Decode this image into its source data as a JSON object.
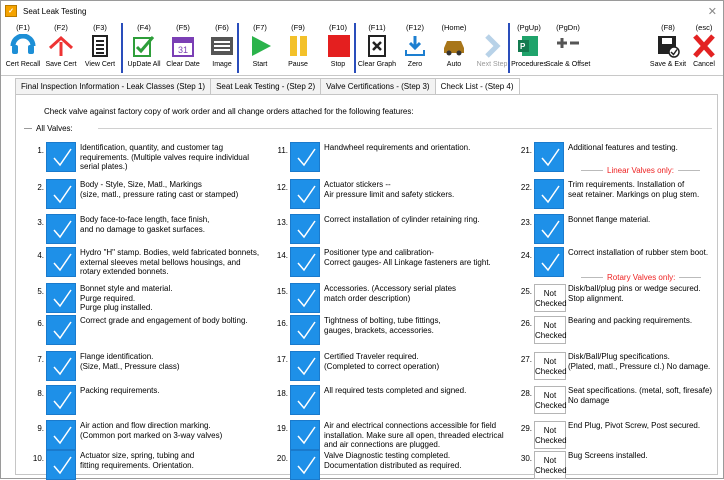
{
  "window": {
    "title": "Seat Leak Testing"
  },
  "toolbar": [
    {
      "key": "(F1)",
      "label": "Cert Recall",
      "icon": "cert-recall-icon"
    },
    {
      "key": "(F2)",
      "label": "Save Cert",
      "icon": "save-cert-icon"
    },
    {
      "key": "(F3)",
      "label": "View Cert",
      "icon": "view-cert-icon"
    },
    {
      "key": "(F4)",
      "label": "UpDate All",
      "icon": "update-all-icon"
    },
    {
      "key": "(F5)",
      "label": "Clear Date",
      "icon": "clear-date-icon"
    },
    {
      "key": "(F6)",
      "label": "Image",
      "icon": "image-icon"
    },
    {
      "key": "(F7)",
      "label": "Start",
      "icon": "start-icon"
    },
    {
      "key": "(F9)",
      "label": "Pause",
      "icon": "pause-icon"
    },
    {
      "key": "(F10)",
      "label": "Stop",
      "icon": "stop-icon"
    },
    {
      "key": "(F11)",
      "label": "Clear Graph",
      "icon": "clear-graph-icon"
    },
    {
      "key": "(F12)",
      "label": "Zero",
      "icon": "zero-icon"
    },
    {
      "key": "(Home)",
      "label": "Auto",
      "icon": "auto-icon"
    },
    {
      "key": "",
      "label": "Next Step",
      "icon": "next-step-icon"
    },
    {
      "key": "(PgUp)",
      "label": "Procedures",
      "icon": "procedures-icon"
    },
    {
      "key": "(PgDn)",
      "label": "Scale & Offset",
      "icon": "scale-offset-icon"
    },
    {
      "key": "(F8)",
      "label": "Save & Exit",
      "icon": "save-exit-icon"
    },
    {
      "key": "(esc)",
      "label": "Cancel",
      "icon": "cancel-icon"
    }
  ],
  "tabs": [
    "Final Inspection Information - Leak Classes (Step 1)",
    "Seat Leak Testing - (Step 2)",
    "Valve Certifications - (Step 3)",
    "Check List - (Step 4)"
  ],
  "active_tab": 3,
  "checklist": {
    "intro": "Check valve against factory copy of work order and all change orders attached for the following features:",
    "group_label": "All Valves:",
    "linear_label": "Linear Valves only:",
    "rotary_label": "Rotary Valves only:",
    "not_checked_label": "Not Checked",
    "items": [
      {
        "n": "1.",
        "text": "Identification, quantity, and customer tag requirements. (Multiple valves require individual serial plates.)",
        "checked": true
      },
      {
        "n": "2.",
        "text": "Body - Style, Size, Matl., Markings\n(size, matl., pressure rating cast or stamped)",
        "checked": true
      },
      {
        "n": "3.",
        "text": "Body face-to-face length, face finish,\nand no damage to gasket surfaces.",
        "checked": true
      },
      {
        "n": "4.",
        "text": "Hydro \"H\" stamp. Bodies, weld fabricated bonnets, external sleeves metal bellows housings, and rotary extended bonnets.",
        "checked": true
      },
      {
        "n": "5.",
        "text": "Bonnet style and material.\nPurge required.\nPurge plug installed.",
        "checked": true
      },
      {
        "n": "6.",
        "text": "Correct grade and engagement of body bolting.",
        "checked": true
      },
      {
        "n": "7.",
        "text": "Flange identification.\n(Size, Matl., Pressure class)",
        "checked": true
      },
      {
        "n": "8.",
        "text": "Packing requirements.",
        "checked": true
      },
      {
        "n": "9.",
        "text": "Air action and flow direction marking.\n(Common port marked on 3-way valves)",
        "checked": true
      },
      {
        "n": "10.",
        "text": "Actuator size, spring, tubing and\nfitting requirements. Orientation.",
        "checked": true
      },
      {
        "n": "11.",
        "text": "Handwheel requirements and orientation.",
        "checked": true
      },
      {
        "n": "12.",
        "text": "Actuator stickers --\nAir pressure limit and safety stickers.",
        "checked": true
      },
      {
        "n": "13.",
        "text": "Correct installation of cylinder retaining ring.",
        "checked": true
      },
      {
        "n": "14.",
        "text": "Positioner type and calibration-\nCorrect gauges- All Linkage fasteners are tight.",
        "checked": true
      },
      {
        "n": "15.",
        "text": "Accessories. (Accessory serial plates\nmatch order description)",
        "checked": true
      },
      {
        "n": "16.",
        "text": "Tightness of bolting, tube fittings,\ngauges, brackets, accessories.",
        "checked": true
      },
      {
        "n": "17.",
        "text": "Certified Traveler required.\n(Completed to correct operation)",
        "checked": true
      },
      {
        "n": "18.",
        "text": "All required tests completed and signed.",
        "checked": true
      },
      {
        "n": "19.",
        "text": "Air and electrical connections accessible for field installation. Make sure all open, threaded electrical and air connections are plugged.",
        "checked": true
      },
      {
        "n": "20.",
        "text": "Valve Diagnostic testing completed.\nDocumentation distributed as required.",
        "checked": true
      },
      {
        "n": "21.",
        "text": "Additional features and testing.",
        "checked": true
      },
      {
        "n": "22.",
        "text": "Trim requirements. Installation of\nseat retainer. Markings on plug stem.",
        "checked": true
      },
      {
        "n": "23.",
        "text": "Bonnet flange material.",
        "checked": true
      },
      {
        "n": "24.",
        "text": "Correct installation of rubber stem boot.",
        "checked": true
      },
      {
        "n": "25.",
        "text": "Disk/ball/plug pins or wedge secured.\nStop alignment.",
        "checked": false
      },
      {
        "n": "26.",
        "text": "Bearing and packing requirements.",
        "checked": false
      },
      {
        "n": "27.",
        "text": "Disk/Ball/Plug specifications.\n(Plated, matl., Pressure cl.) No damage.",
        "checked": false
      },
      {
        "n": "28.",
        "text": "Seat specifications. (metal, soft, firesafe)\nNo damage",
        "checked": false
      },
      {
        "n": "29.",
        "text": "End Plug, Pivot Screw, Post secured.",
        "checked": false
      },
      {
        "n": "30.",
        "text": "Bug Screens installed.",
        "checked": false
      }
    ]
  }
}
